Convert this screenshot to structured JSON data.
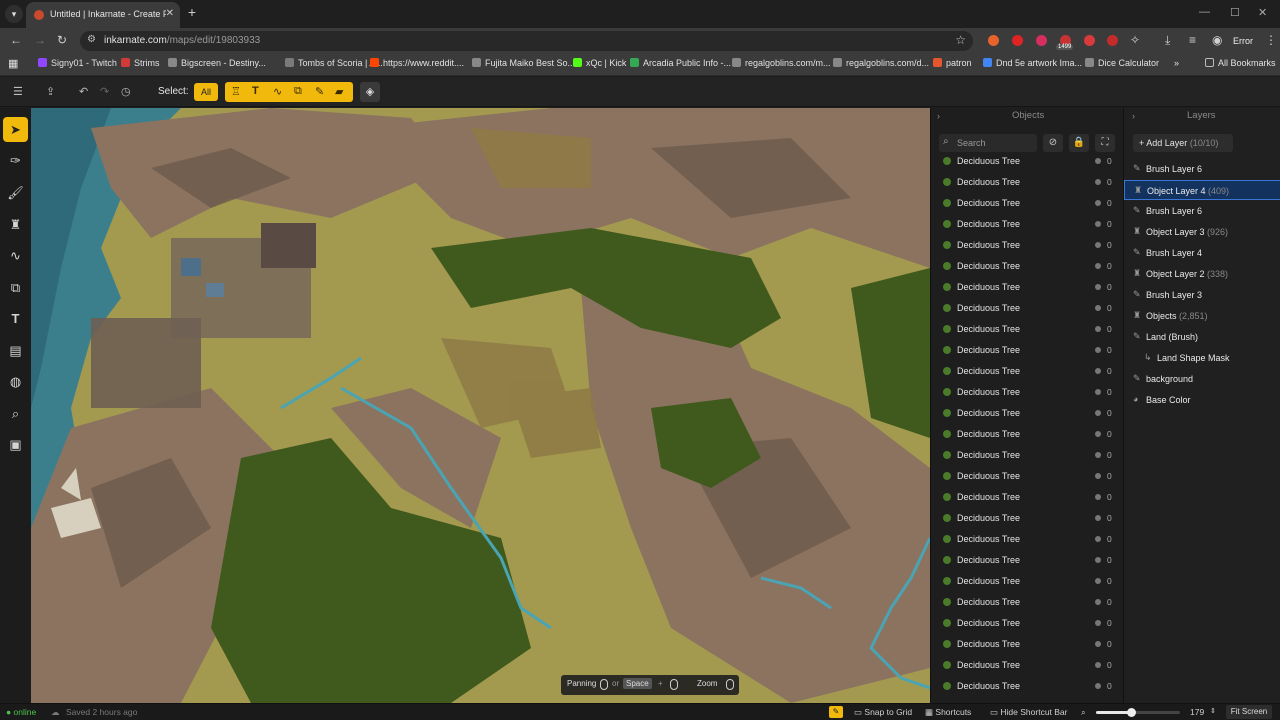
{
  "browser": {
    "tab_title": "Untitled | Inkarnate - Create Fa",
    "url_host": "inkarnate.com",
    "url_path": "/maps/edit/19803933",
    "extension_badge": "1499",
    "error_label": "Error",
    "bookmarks": [
      {
        "label": "Signy01 - Twitch",
        "color": "#9146ff"
      },
      {
        "label": "Strims",
        "color": "#d23a3a"
      },
      {
        "label": "Bigscreen - Destiny...",
        "color": "#888888"
      },
      {
        "label": "Tombs of Scoria | Ar...",
        "color": "#7a7a7a"
      },
      {
        "label": "https://www.reddit....",
        "color": "#ff4500"
      },
      {
        "label": "Fujita Maiko Best So...",
        "color": "#888888"
      },
      {
        "label": "xQc | Kick",
        "color": "#53fc18"
      },
      {
        "label": "Arcadia Public Info -...",
        "color": "#34a853"
      },
      {
        "label": "regalgoblins.com/m...",
        "color": "#888888"
      },
      {
        "label": "regalgoblins.com/d...",
        "color": "#888888"
      },
      {
        "label": "patron",
        "color": "#e4572e"
      },
      {
        "label": "Dnd 5e artwork Ima...",
        "color": "#4285f4"
      },
      {
        "label": "Dice Calculator",
        "color": "#888888"
      }
    ],
    "all_bookmarks": "All Bookmarks"
  },
  "toolbar": {
    "select_label": "Select:",
    "select_all": "All"
  },
  "hud": {
    "panning": "Panning",
    "or": "or",
    "space": "Space",
    "plus": "+",
    "zoom": "Zoom"
  },
  "objects_panel": {
    "title": "Objects",
    "search_placeholder": "Search",
    "items": [
      {
        "name": "Deciduous Tree",
        "count": "0"
      },
      {
        "name": "Deciduous Tree",
        "count": "0"
      },
      {
        "name": "Deciduous Tree",
        "count": "0"
      },
      {
        "name": "Deciduous Tree",
        "count": "0"
      },
      {
        "name": "Deciduous Tree",
        "count": "0"
      },
      {
        "name": "Deciduous Tree",
        "count": "0"
      },
      {
        "name": "Deciduous Tree",
        "count": "0"
      },
      {
        "name": "Deciduous Tree",
        "count": "0"
      },
      {
        "name": "Deciduous Tree",
        "count": "0"
      },
      {
        "name": "Deciduous Tree",
        "count": "0"
      },
      {
        "name": "Deciduous Tree",
        "count": "0"
      },
      {
        "name": "Deciduous Tree",
        "count": "0"
      },
      {
        "name": "Deciduous Tree",
        "count": "0"
      },
      {
        "name": "Deciduous Tree",
        "count": "0"
      },
      {
        "name": "Deciduous Tree",
        "count": "0"
      },
      {
        "name": "Deciduous Tree",
        "count": "0"
      },
      {
        "name": "Deciduous Tree",
        "count": "0"
      },
      {
        "name": "Deciduous Tree",
        "count": "0"
      },
      {
        "name": "Deciduous Tree",
        "count": "0"
      },
      {
        "name": "Deciduous Tree",
        "count": "0"
      },
      {
        "name": "Deciduous Tree",
        "count": "0"
      },
      {
        "name": "Deciduous Tree",
        "count": "0"
      },
      {
        "name": "Deciduous Tree",
        "count": "0"
      },
      {
        "name": "Deciduous Tree",
        "count": "0"
      },
      {
        "name": "Deciduous Tree",
        "count": "0"
      },
      {
        "name": "Deciduous Tree",
        "count": "0"
      },
      {
        "name": "Deciduous Tree",
        "count": "0"
      }
    ]
  },
  "layers_panel": {
    "title": "Layers",
    "add_label": "Add Layer",
    "add_count": "(10/10)",
    "layers": [
      {
        "name": "Brush Layer 6",
        "count": "",
        "icon": "brush-icon",
        "selected": false
      },
      {
        "name": "Object Layer 4",
        "count": "(409)",
        "icon": "object-icon",
        "selected": true
      },
      {
        "name": "Brush Layer 6",
        "count": "",
        "icon": "brush-icon",
        "selected": false
      },
      {
        "name": "Object Layer 3",
        "count": "(926)",
        "icon": "object-icon",
        "selected": false
      },
      {
        "name": "Brush Layer 4",
        "count": "",
        "icon": "brush-icon",
        "selected": false
      },
      {
        "name": "Object Layer 2",
        "count": "(338)",
        "icon": "object-icon",
        "selected": false
      },
      {
        "name": "Brush Layer 3",
        "count": "",
        "icon": "brush-icon",
        "selected": false
      },
      {
        "name": "Objects",
        "count": "(2,851)",
        "icon": "object-icon",
        "selected": false
      },
      {
        "name": "Land (Brush)",
        "count": "",
        "icon": "brush-icon",
        "selected": false
      },
      {
        "name": "Land Shape Mask",
        "count": "",
        "icon": "mask-icon",
        "selected": false
      },
      {
        "name": "background",
        "count": "",
        "icon": "brush-icon",
        "selected": false
      },
      {
        "name": "Base Color",
        "count": "",
        "icon": "palette-icon",
        "selected": false
      }
    ]
  },
  "status": {
    "online": "online",
    "saved": "Saved 2 hours ago",
    "snap": "Snap to Grid",
    "shortcuts": "Shortcuts",
    "hide_shortcut": "Hide Shortcut Bar",
    "zoom_value": "179",
    "zoom_fraction": 0.42,
    "fit": "Fit Screen"
  }
}
